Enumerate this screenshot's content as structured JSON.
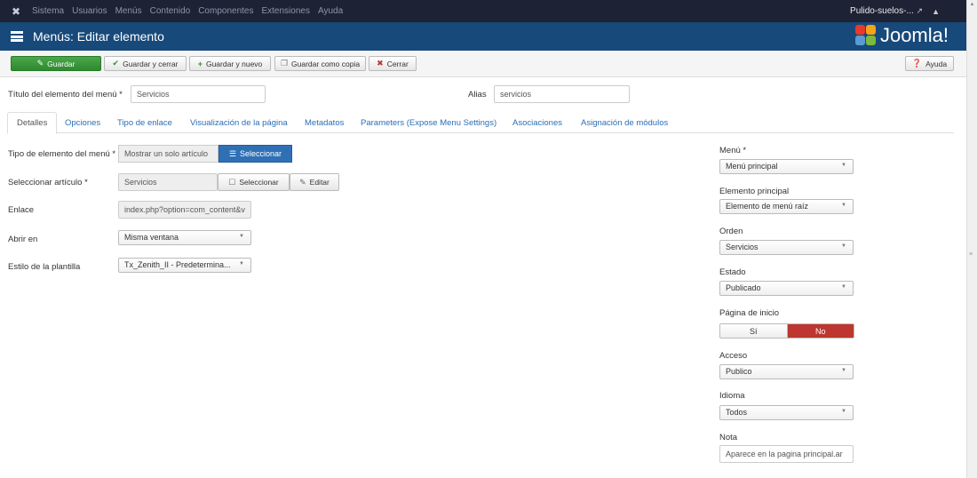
{
  "navbar": {
    "menu": [
      "Sistema",
      "Usuarios",
      "Menús",
      "Contenido",
      "Componentes",
      "Extensiones",
      "Ayuda"
    ],
    "site_name": "Pulido-suelos-...",
    "user_icon": "user-icon"
  },
  "header": {
    "title": "Menús: Editar elemento",
    "logo_text": "Joomla!"
  },
  "toolbar": {
    "save": "Guardar",
    "save_close": "Guardar y cerrar",
    "save_new": "Guardar y nuevo",
    "save_copy": "Guardar como copia",
    "close": "Cerrar",
    "help": "Ayuda"
  },
  "title_field": {
    "label": "Título del elemento del menú *",
    "value": "Servicios"
  },
  "alias_field": {
    "label": "Alias",
    "value": "servicios"
  },
  "tabs": [
    "Detalles",
    "Opciones",
    "Tipo de enlace",
    "Visualización de la página",
    "Metadatos",
    "Parameters (Expose Menu Settings)",
    "Asociaciones",
    "Asignación de módulos"
  ],
  "details": {
    "type_label": "Tipo de elemento del menú *",
    "type_value": "Mostrar un solo artículo",
    "type_button": "Seleccionar",
    "article_label": "Seleccionar artículo *",
    "article_value": "Servicios",
    "article_select": "Seleccionar",
    "article_edit": "Editar",
    "link_label": "Enlace",
    "link_value": "index.php?option=com_content&v",
    "open_label": "Abrir en",
    "open_value": "Misma ventana",
    "style_label": "Estilo de la plantilla",
    "style_value": "Tx_Zenith_II - Predetermina..."
  },
  "sidebar": {
    "menu_label": "Menú *",
    "menu_value": "Menú principal",
    "parent_label": "Elemento principal",
    "parent_value": "Elemento de menú raíz",
    "order_label": "Orden",
    "order_value": "Servicios",
    "status_label": "Estado",
    "status_value": "Publicado",
    "home_label": "Página de inicio",
    "home_yes": "Sí",
    "home_no": "No",
    "access_label": "Acceso",
    "access_value": "Publico",
    "language_label": "Idioma",
    "language_value": "Todos",
    "note_label": "Nota",
    "note_value": "Aparece en la pagina principal.ar"
  },
  "colors": {
    "navbar": "#1d2334",
    "header": "#17497a",
    "save": "#3a9a3a",
    "select_button": "#2f70b5",
    "home_no": "#bd362f"
  }
}
